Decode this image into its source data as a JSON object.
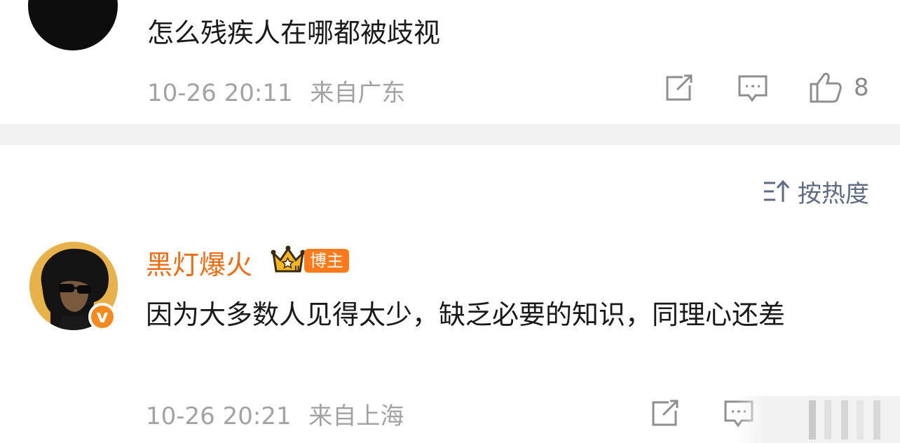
{
  "comment_1": {
    "text": "怎么残疾人在哪都被歧视",
    "timestamp": "10-26 20:11",
    "location": "来自广东",
    "like_count": "8"
  },
  "sort": {
    "label": "按热度"
  },
  "comment_2": {
    "username": "黑灯爆火",
    "author_badge": "博主",
    "verified_glyph": "v",
    "crown_rank": "II",
    "text": "因为大多数人见得太少，缺乏必要的知识，同理心还差",
    "timestamp": "10-26 20:21",
    "location": "来自上海"
  },
  "icons": {
    "share": "share-icon",
    "comment": "comment-icon",
    "like": "thumbs-up-icon",
    "sort": "sort-icon",
    "crown": "crown-icon"
  },
  "colors": {
    "username": "#f26b11",
    "badge": "#ff7a1a",
    "meta": "#a3a3a3",
    "sort": "#5e6b84",
    "divider": "#f2f2f2"
  }
}
